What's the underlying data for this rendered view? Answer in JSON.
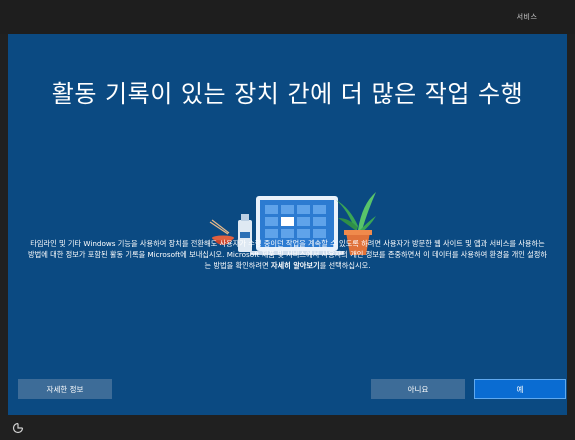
{
  "topbar": {
    "tab_label": "서비스"
  },
  "main": {
    "title": "활동 기록이 있는 장치 간에 더 많은 작업 수행",
    "description_part1": "타임라인 및 기타 Windows 기능을 사용하여 장치를 전환해도 사용자가 수행 중이던 작업을 계속할 수 있도록 하려면 사용자가 방문한 웹 사이트 및 앱과 서비스를 사용하는 방법에 대한 정보가 포함된 활동 기록을 Microsoft에 보내십시오. Microsoft 제품 및 서비스에서 사용자의 개인 정보를 존중하면서 이 데이터를 사용하여 환경을 개인 설정하는 방법을 확인하려면 ",
    "description_bold": "자세히 알아보기",
    "description_part2": "를 선택하십시오."
  },
  "buttons": {
    "info_label": "자세한 정보",
    "no_label": "아니요",
    "yes_label": "예"
  },
  "icons": {
    "bottom_left": "accessibility-icon"
  },
  "colors": {
    "panel_background": "#0b4a82",
    "primary_button": "#0a6cd2",
    "secondary_button": "#3d6c98"
  }
}
